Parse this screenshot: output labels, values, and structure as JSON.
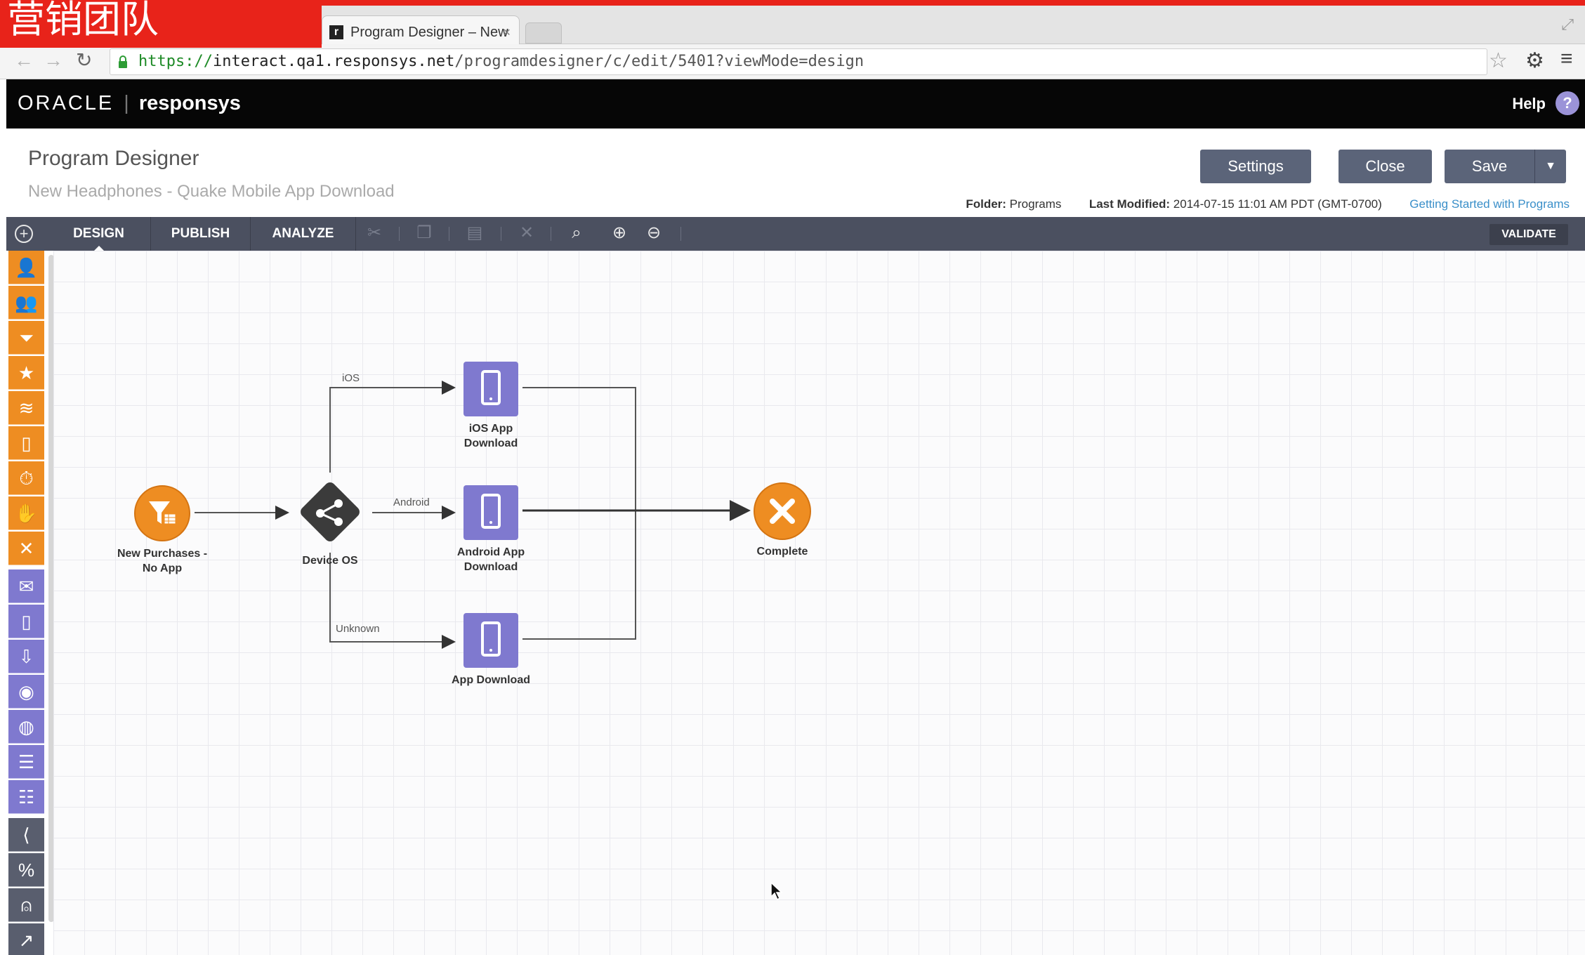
{
  "watermark": "营销团队",
  "browser": {
    "tab_title": "Program Designer – New",
    "tab_favicon": "r",
    "url_scheme": "https://",
    "url_host": "interact.qa1.responsys.net",
    "url_path": "/programdesigner/c/edit/5401?viewMode=design"
  },
  "header": {
    "brand_oracle": "ORACLE",
    "brand_sep": "|",
    "brand_product": "responsys",
    "help_label": "Help",
    "help_icon": "?"
  },
  "page": {
    "title": "Program Designer",
    "subtitle": "New Headphones - Quake Mobile App Download",
    "buttons": {
      "settings": "Settings",
      "close": "Close",
      "save": "Save",
      "save_dropdown": "▼"
    },
    "folder_label": "Folder:",
    "folder_value": "Programs",
    "modified_label": "Last Modified:",
    "modified_value": "2014-07-15 11:01 AM PDT (GMT-0700)",
    "help_link": "Getting Started with Programs"
  },
  "toolbar": {
    "tabs": [
      "DESIGN",
      "PUBLISH",
      "ANALYZE"
    ],
    "active_tab": "DESIGN",
    "validate_label": "VALIDATE"
  },
  "palette": {
    "items": [
      {
        "icon": "person-icon",
        "color": "orange"
      },
      {
        "icon": "person-add-icon",
        "color": "orange"
      },
      {
        "icon": "filter-icon",
        "color": "orange"
      },
      {
        "icon": "star-icon",
        "color": "orange"
      },
      {
        "icon": "wifi-icon",
        "color": "orange"
      },
      {
        "icon": "mobile-icon",
        "color": "orange"
      },
      {
        "icon": "timer-icon",
        "color": "orange"
      },
      {
        "icon": "hand-icon",
        "color": "orange"
      },
      {
        "icon": "close-icon",
        "color": "orange"
      },
      {
        "icon": "email-icon",
        "color": "purple"
      },
      {
        "icon": "phone-icon",
        "color": "purple"
      },
      {
        "icon": "download-icon",
        "color": "purple"
      },
      {
        "icon": "data-icon",
        "color": "purple"
      },
      {
        "icon": "database-icon",
        "color": "purple"
      },
      {
        "icon": "form-icon",
        "color": "purple"
      },
      {
        "icon": "form-alt-icon",
        "color": "purple"
      },
      {
        "icon": "split-icon",
        "color": "gray"
      },
      {
        "icon": "percent-icon",
        "color": "gray"
      },
      {
        "icon": "badge-icon",
        "color": "gray"
      },
      {
        "icon": "trend-icon",
        "color": "gray"
      }
    ]
  },
  "flow": {
    "nodes": {
      "start": {
        "label": "New Purchases - No App"
      },
      "switch": {
        "label": "Device OS"
      },
      "ios": {
        "label": "iOS App Download"
      },
      "android": {
        "label": "Android App Download"
      },
      "unknown": {
        "label": "App Download"
      },
      "complete": {
        "label": "Complete"
      }
    },
    "edges": {
      "ios": "iOS",
      "android": "Android",
      "unknown": "Unknown"
    }
  },
  "colors": {
    "orange": "#ee8d22",
    "purple": "#7f79cf",
    "dark": "#4b5060",
    "switch": "#3b3b3b"
  }
}
